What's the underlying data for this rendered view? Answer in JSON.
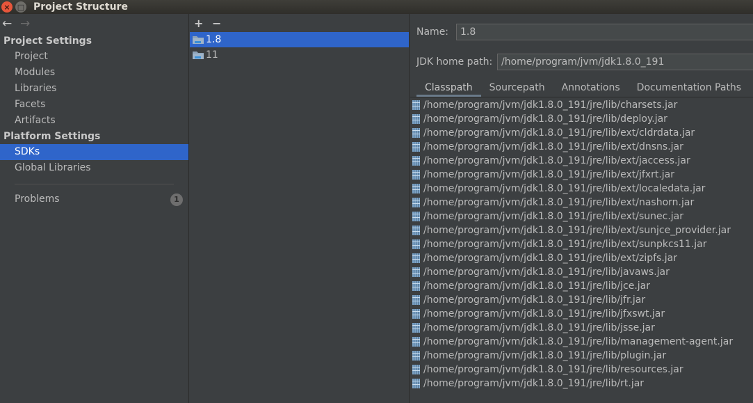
{
  "window": {
    "title": "Project Structure",
    "close_glyph": "×",
    "max_glyph": "□"
  },
  "nav": {
    "back": "←",
    "forward": "→"
  },
  "sidebar": {
    "project_settings_header": "Project Settings",
    "project_items": [
      "Project",
      "Modules",
      "Libraries",
      "Facets",
      "Artifacts"
    ],
    "platform_settings_header": "Platform Settings",
    "platform_items": [
      "SDKs",
      "Global Libraries"
    ],
    "selected": "SDKs",
    "problems_label": "Problems",
    "problems_count": "1"
  },
  "sdk_list": {
    "add": "+",
    "remove": "−",
    "items": [
      "1.8",
      "11"
    ],
    "selected": "1.8"
  },
  "detail": {
    "name_label": "Name:",
    "name_value": "1.8",
    "home_label": "JDK home path:",
    "home_value": "/home/program/jvm/jdk1.8.0_191",
    "tabs": [
      "Classpath",
      "Sourcepath",
      "Annotations",
      "Documentation Paths"
    ],
    "active_tab": "Classpath",
    "classpath": [
      "/home/program/jvm/jdk1.8.0_191/jre/lib/charsets.jar",
      "/home/program/jvm/jdk1.8.0_191/jre/lib/deploy.jar",
      "/home/program/jvm/jdk1.8.0_191/jre/lib/ext/cldrdata.jar",
      "/home/program/jvm/jdk1.8.0_191/jre/lib/ext/dnsns.jar",
      "/home/program/jvm/jdk1.8.0_191/jre/lib/ext/jaccess.jar",
      "/home/program/jvm/jdk1.8.0_191/jre/lib/ext/jfxrt.jar",
      "/home/program/jvm/jdk1.8.0_191/jre/lib/ext/localedata.jar",
      "/home/program/jvm/jdk1.8.0_191/jre/lib/ext/nashorn.jar",
      "/home/program/jvm/jdk1.8.0_191/jre/lib/ext/sunec.jar",
      "/home/program/jvm/jdk1.8.0_191/jre/lib/ext/sunjce_provider.jar",
      "/home/program/jvm/jdk1.8.0_191/jre/lib/ext/sunpkcs11.jar",
      "/home/program/jvm/jdk1.8.0_191/jre/lib/ext/zipfs.jar",
      "/home/program/jvm/jdk1.8.0_191/jre/lib/javaws.jar",
      "/home/program/jvm/jdk1.8.0_191/jre/lib/jce.jar",
      "/home/program/jvm/jdk1.8.0_191/jre/lib/jfr.jar",
      "/home/program/jvm/jdk1.8.0_191/jre/lib/jfxswt.jar",
      "/home/program/jvm/jdk1.8.0_191/jre/lib/jsse.jar",
      "/home/program/jvm/jdk1.8.0_191/jre/lib/management-agent.jar",
      "/home/program/jvm/jdk1.8.0_191/jre/lib/plugin.jar",
      "/home/program/jvm/jdk1.8.0_191/jre/lib/resources.jar",
      "/home/program/jvm/jdk1.8.0_191/jre/lib/rt.jar"
    ]
  },
  "icons": {
    "sdk": "folder-icon",
    "classpath_entry": "jar-icon"
  },
  "colors": {
    "selection": "#2f65ca",
    "background": "#3c3f41",
    "text": "#bbbbbb"
  }
}
